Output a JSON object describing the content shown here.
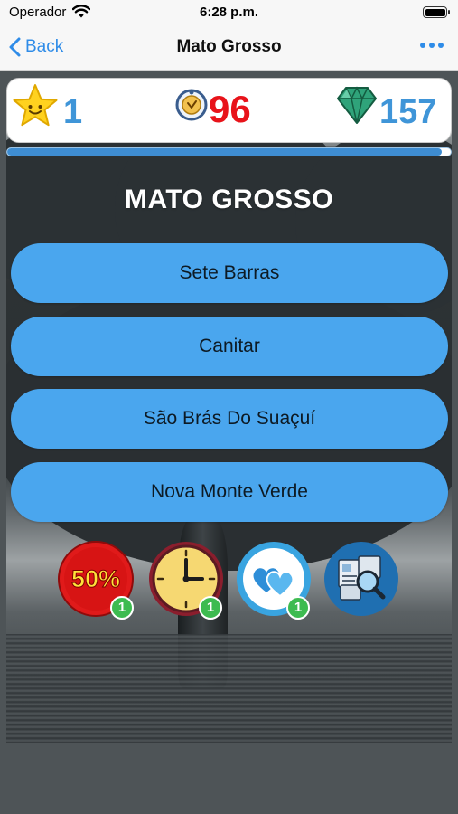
{
  "status_bar": {
    "carrier": "Operador",
    "time": "6:28 p.m."
  },
  "nav": {
    "back_label": "Back",
    "title": "Mato Grosso",
    "back_icon": "chevron-left-icon",
    "more_icon": "more-icon"
  },
  "scoreboard": {
    "stars": "1",
    "lives": "96",
    "gems": "157",
    "star_icon": "star-icon",
    "lives_icon": "lives-icon",
    "gem_icon": "gem-icon"
  },
  "progress": {
    "fraction": 0.98
  },
  "question": {
    "title": "MATO GROSSO"
  },
  "answers": [
    {
      "label": "Sete Barras"
    },
    {
      "label": "Canitar"
    },
    {
      "label": "São Brás Do Suaçuí"
    },
    {
      "label": "Nova Monte Verde"
    }
  ],
  "powerups": [
    {
      "name": "fifty-fifty",
      "label": "50%",
      "count": "1",
      "icon": "fifty-percent-icon"
    },
    {
      "name": "time",
      "count": "1",
      "icon": "clock-icon"
    },
    {
      "name": "extra-life",
      "count": "1",
      "icon": "hearts-icon"
    },
    {
      "name": "hint",
      "icon": "search-hint-icon"
    }
  ],
  "colors": {
    "accent_blue": "#3f95d8",
    "answer_blue": "#4aa6ee",
    "lives_red": "#e8131a",
    "nav_blue": "#2f8ce8",
    "badge_green": "#3dbb50"
  }
}
